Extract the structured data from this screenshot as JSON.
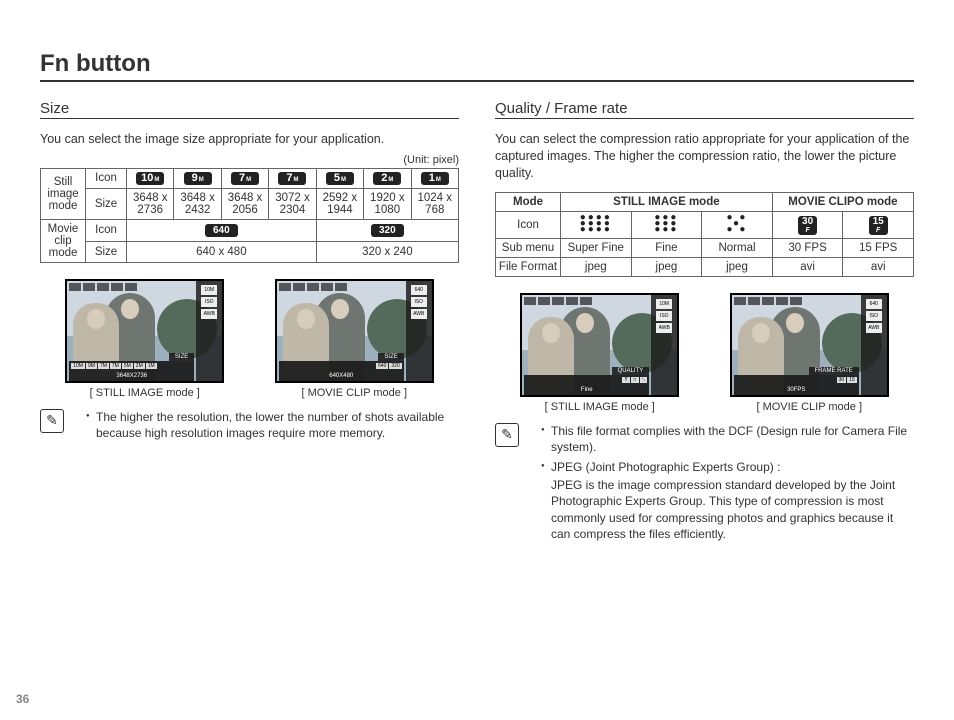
{
  "page_title": "Fn button",
  "page_number": "36",
  "left": {
    "heading": "Size",
    "intro": "You can select the image size appropriate for your application.",
    "unit": "(Unit: pixel)",
    "still_label": "Still image mode",
    "movie_label": "Movie clip mode",
    "row_icon": "Icon",
    "row_size": "Size",
    "still_icons": {
      "i1": "10",
      "i2": "9",
      "i3": "7",
      "i4": "7",
      "i5": "5",
      "i6": "2",
      "i7": "1"
    },
    "still_sizes": {
      "s1": "3648 x 2736",
      "s2": "3648 x 2432",
      "s3": "3648 x 2056",
      "s4": "3072 x 2304",
      "s5": "2592 x 1944",
      "s6": "1920 x 1080",
      "s7": "1024 x 768"
    },
    "movie_icons": {
      "m1": "640",
      "m2": "320"
    },
    "movie_sizes": {
      "ms1": "640 x 480",
      "ms2": "320 x 240"
    },
    "shot1": {
      "tag": "SIZE",
      "strip": [
        "10M",
        "9M",
        "7M",
        "7M",
        "5M",
        "2M",
        "1M"
      ],
      "val": "3648X2736",
      "caption": "[ STILL IMAGE mode ]"
    },
    "shot2": {
      "tag": "SIZE",
      "strip": [
        "640",
        "320"
      ],
      "val": "640X480",
      "caption": "[ MOVIE CLIP mode ]"
    },
    "note1": "The higher the resolution, the lower the number of shots available because high resolution images require more memory."
  },
  "right": {
    "heading": "Quality / Frame rate",
    "intro": "You can select the compression ratio appropriate for your application of the captured images. The higher the compression ratio, the lower the picture quality.",
    "headers": {
      "mode": "Mode",
      "still": "STILL IMAGE mode",
      "movie": "MOVIE CLIPO mode"
    },
    "rows": {
      "icon": "Icon",
      "sub": "Sub menu",
      "file": "File Format"
    },
    "sub": {
      "c1": "Super Fine",
      "c2": "Fine",
      "c3": "Normal",
      "c4": "30 FPS",
      "c5": "15 FPS"
    },
    "file": {
      "c1": "jpeg",
      "c2": "jpeg",
      "c3": "jpeg",
      "c4": "avi",
      "c5": "avi"
    },
    "rate_icons": {
      "r1": "30",
      "r2": "15",
      "rf": "F"
    },
    "shot1": {
      "tag": "QUALITY",
      "strip": [
        "",
        "",
        ""
      ],
      "val": "Fine",
      "caption": "[ STILL IMAGE mode ]"
    },
    "shot2": {
      "tag": "FRAME RATE",
      "strip": [
        "30",
        "15"
      ],
      "val": "30FPS",
      "caption": "[ MOVIE CLIP mode ]"
    },
    "note1": "This file format complies with the DCF (Design rule for Camera File system).",
    "note2": "JPEG (Joint Photographic Experts Group) :",
    "note2sub": "JPEG is the image compression standard developed by the Joint Photographic Experts Group. This type of compression is most commonly used for compressing photos and graphics because it can compress the files efficiently."
  }
}
